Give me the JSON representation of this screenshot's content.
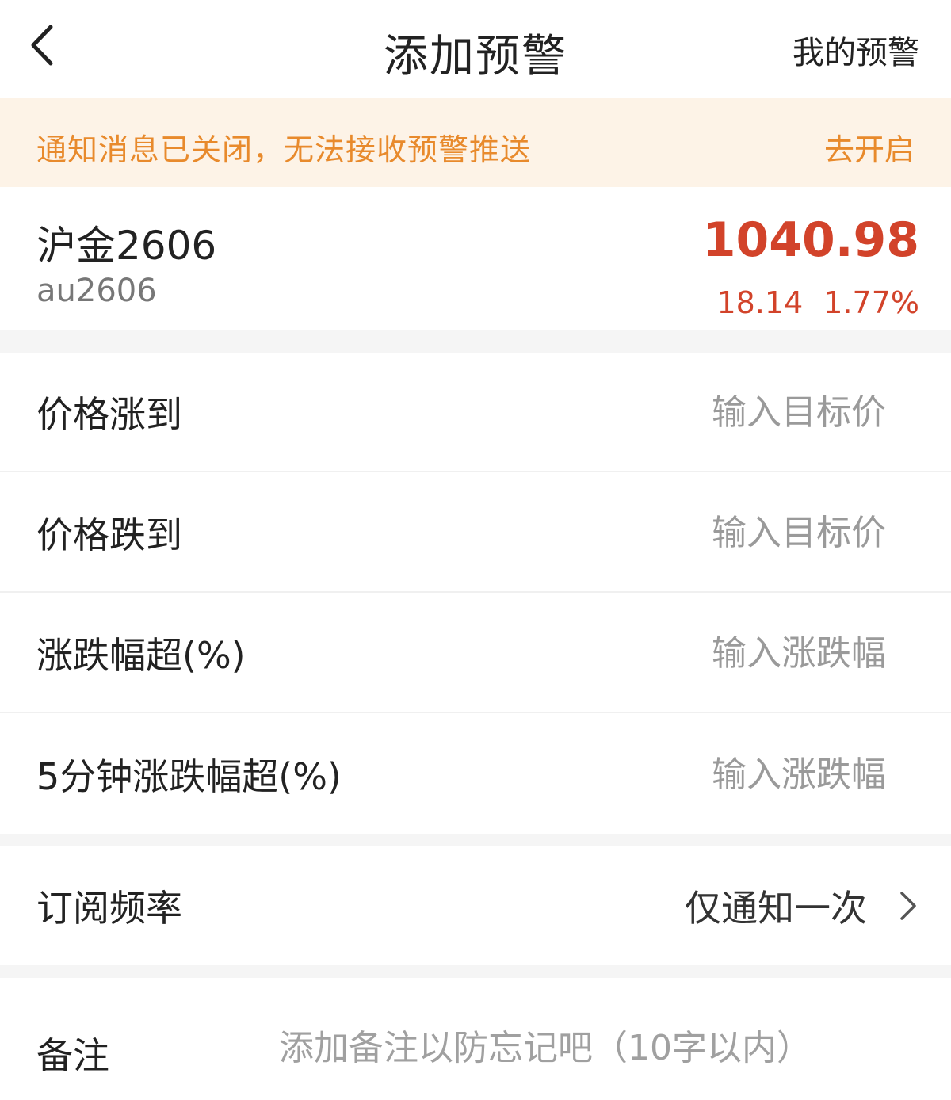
{
  "header": {
    "title": "添加预警",
    "my_alerts": "我的预警",
    "back_icon": "chevron-left-icon"
  },
  "notice": {
    "text": "通知消息已关闭，无法接收预警推送",
    "action": "去开启",
    "color": "#e88a2c",
    "background": "#fdf3e7"
  },
  "quote": {
    "name": "沪金2606",
    "code": "au2606",
    "price": "1040.98",
    "change": "18.14",
    "change_pct": "1.77%",
    "color": "#d2432a"
  },
  "alerts": [
    {
      "label": "价格涨到",
      "placeholder": "输入目标价",
      "value": ""
    },
    {
      "label": "价格跌到",
      "placeholder": "输入目标价",
      "value": ""
    },
    {
      "label": "涨跌幅超(%)",
      "placeholder": "输入涨跌幅",
      "value": ""
    },
    {
      "label": "5分钟涨跌幅超(%)",
      "placeholder": "输入涨跌幅",
      "value": ""
    }
  ],
  "frequency": {
    "label": "订阅频率",
    "value": "仅通知一次",
    "icon": "chevron-right-icon"
  },
  "note": {
    "label": "备注",
    "placeholder": "添加备注以防忘记吧（10字以内）",
    "value": ""
  }
}
